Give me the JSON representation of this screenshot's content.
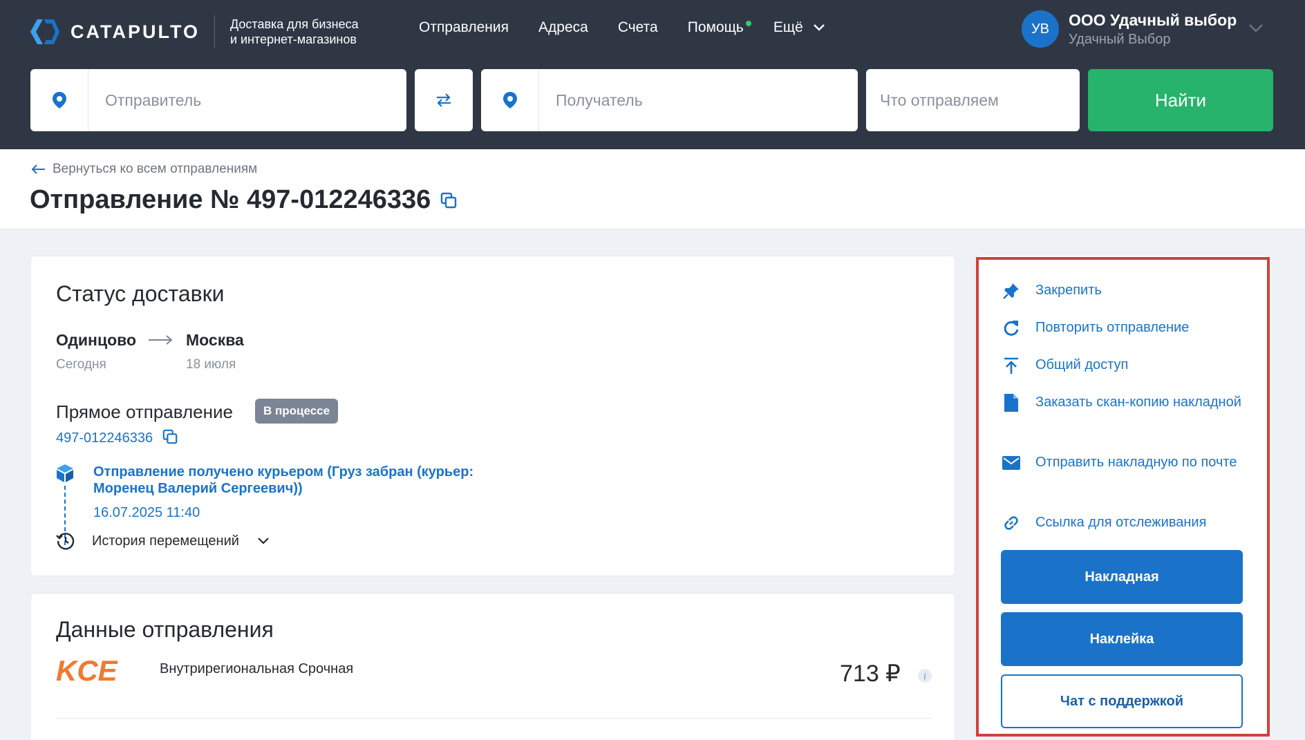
{
  "header": {
    "brand": "CATAPULTO",
    "tagline_line1": "Доставка для бизнеса",
    "tagline_line2": "и интернет-магазинов",
    "nav": [
      "Отправления",
      "Адреса",
      "Счета",
      "Помощь",
      "Ещё"
    ],
    "account": {
      "initials": "УВ",
      "name": "ООО Удачный выбор",
      "subtitle": "Удачный Выбор"
    }
  },
  "search": {
    "sender_placeholder": "Отправитель",
    "recipient_placeholder": "Получатель",
    "what_placeholder": "Что отправляем",
    "find_label": "Найти"
  },
  "page": {
    "back_link": "Вернуться ко всем отправлениям",
    "title": "Отправление № 497-012246336"
  },
  "status_card": {
    "title": "Статус доставки",
    "from_city": "Одинцово",
    "from_date": "Сегодня",
    "to_city": "Москва",
    "to_date": "18 июля",
    "direct_title": "Прямое отправление",
    "badge": "В процессе",
    "tracking_number": "497-012246336",
    "event_text": "Отправление получено курьером (Груз забран (курьер: Моренец Валерий Сергеевич))",
    "event_time": "16.07.2025 11:40",
    "history_label": "История перемещений"
  },
  "data_card": {
    "title": "Данные отправления",
    "carrier_logo_text": "KCE",
    "service_name": "Внутрирегиональная Срочная",
    "price": "713 ₽"
  },
  "actions": {
    "items": [
      {
        "label": "Закрепить",
        "icon": "pin-icon"
      },
      {
        "label": "Повторить отправление",
        "icon": "refresh-icon"
      },
      {
        "label": "Общий доступ",
        "icon": "share-upload-icon"
      },
      {
        "label": "Заказать скан-копию накладной",
        "icon": "document-icon"
      },
      {
        "label": "Отправить накладную по почте",
        "icon": "mail-icon"
      },
      {
        "label": "Ссылка для отслеживания",
        "icon": "link-icon"
      }
    ],
    "waybill_button": "Накладная",
    "sticker_button": "Наклейка",
    "support_button": "Чат с поддержкой"
  },
  "colors": {
    "header_bg": "#2f3745",
    "accent_blue": "#1a73c9",
    "find_green": "#27b36b",
    "badge_gray": "#7b8595",
    "carrier_orange": "#f07a2e",
    "highlight_red": "#d0403d"
  }
}
